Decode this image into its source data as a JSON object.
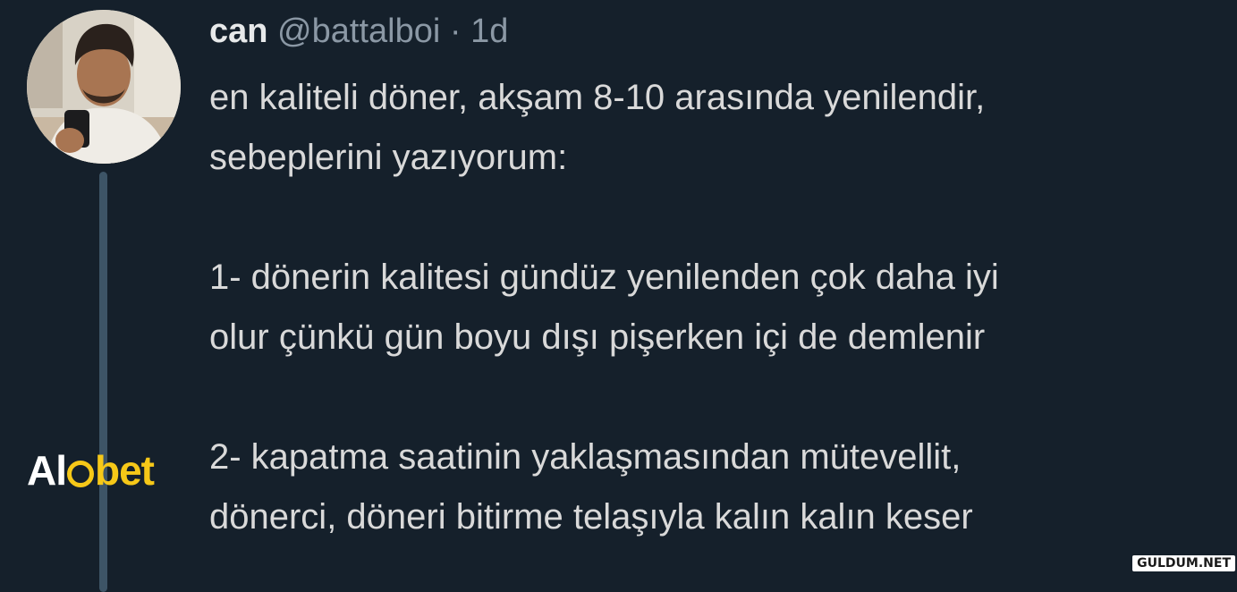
{
  "tweet": {
    "display_name": "can",
    "handle": "@battalboi",
    "separator": "·",
    "time": "1d",
    "lines": [
      "en kaliteli döner, akşam 8-10 arasında yenilendir,",
      "sebeplerini yazıyorum:",
      "",
      "1- dönerin kalitesi gündüz yenilenden çok daha iyi",
      "olur çünkü gün boyu dışı pişerken içi de demlenir",
      "",
      "2- kapatma saatinin yaklaşmasından mütevellit,",
      "dönerci, döneri bitirme telaşıyla kalın kalın keser"
    ]
  },
  "sponsor_logo": {
    "part_a": "Al",
    "part_b": "bet"
  },
  "watermark": {
    "text": "GULDUM.NET"
  },
  "colors": {
    "background": "#15202b",
    "text": "#d9d9d9",
    "muted": "#8b98a5",
    "thread_line": "#3d5466",
    "logo_accent": "#f6c818"
  }
}
